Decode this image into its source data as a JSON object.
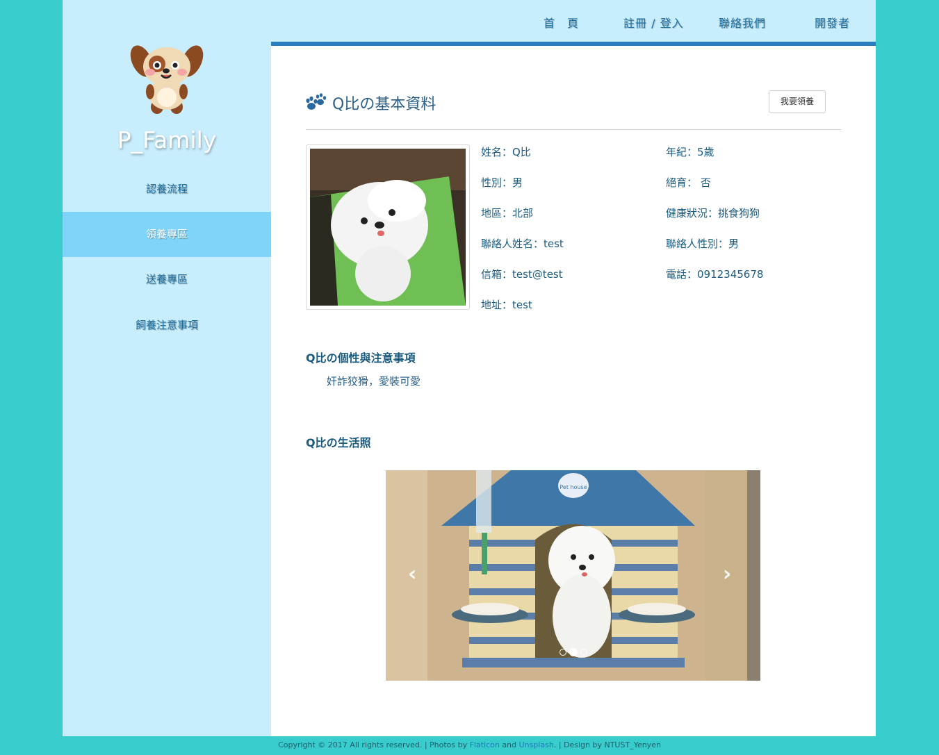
{
  "nav": {
    "home": "首　頁",
    "register": "註冊 / 登入",
    "contact": "聯絡我們",
    "developer": "開發者"
  },
  "sidebar": {
    "brand": "P_Family",
    "items": [
      {
        "label": "認養流程"
      },
      {
        "label": "領養專區"
      },
      {
        "label": "送養專區"
      },
      {
        "label": "飼養注意事項"
      }
    ]
  },
  "main": {
    "title": "Q比の基本資料",
    "adopt_button": "我要領養",
    "info": {
      "name": "姓名：Q比",
      "age": "年紀：5歲",
      "gender": "性別：男",
      "neutered": "絕育： 否",
      "region": "地區：北部",
      "health": "健康狀況：挑食狗狗",
      "contact_name": "聯絡人姓名：test",
      "contact_gender": "聯絡人性別：男",
      "email": "信箱：test@test",
      "phone": "電話：0912345678",
      "address": "地址：test"
    },
    "personality_title": "Q比の個性與注意事項",
    "personality_text": "奸詐狡猾，愛裝可愛",
    "photos_title": "Q比の生活照",
    "carousel": {
      "prev": "‹",
      "next": "›",
      "house_text": "Pet house",
      "slide_count": 3,
      "active_slide": 2
    }
  },
  "footer": {
    "text1": "Copyright © 2017 All rights reserved. | Photos by ",
    "flaticon": "Flaticon",
    "and": " and ",
    "unsplash": "Unsplash",
    "text2": ". | Design by NTUST_Yenyen"
  },
  "colors": {
    "background": "#38cdcc",
    "sidebar": "#c8edfc",
    "active_item": "#7fd4f9",
    "accent_line": "#2a80bf",
    "text_primary": "#1a5a7e"
  }
}
